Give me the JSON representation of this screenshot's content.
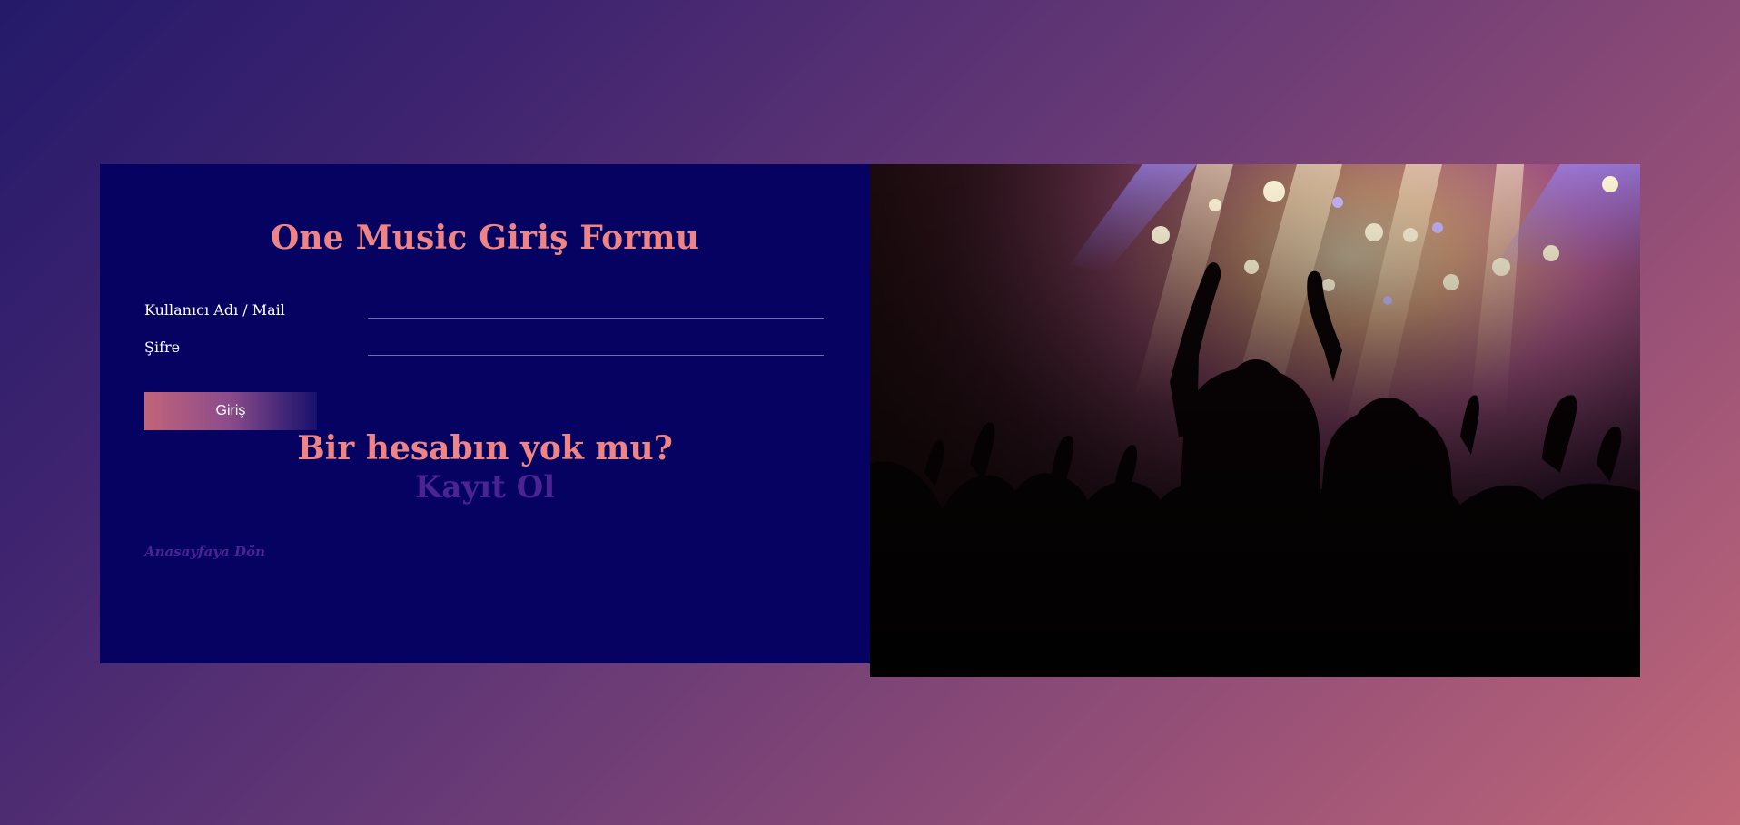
{
  "form": {
    "title": "One Music Giriş Formu",
    "username_label": "Kullanıcı Adı / Mail",
    "username_value": "",
    "password_label": "Şifre",
    "password_value": "",
    "login_button": "Giriş",
    "no_account_text": "Bir hesabın yok mu?",
    "register_link": "Kayıt Ol",
    "home_link": "Anasayfaya Dön"
  },
  "image": {
    "subject": "concert-crowd-photo"
  },
  "colors": {
    "card_background": "#050262",
    "heading_accent": "#ef8486",
    "link_purple": "#4a2492",
    "button_gradient_start": "#c26479",
    "button_gradient_end": "#17106c"
  }
}
